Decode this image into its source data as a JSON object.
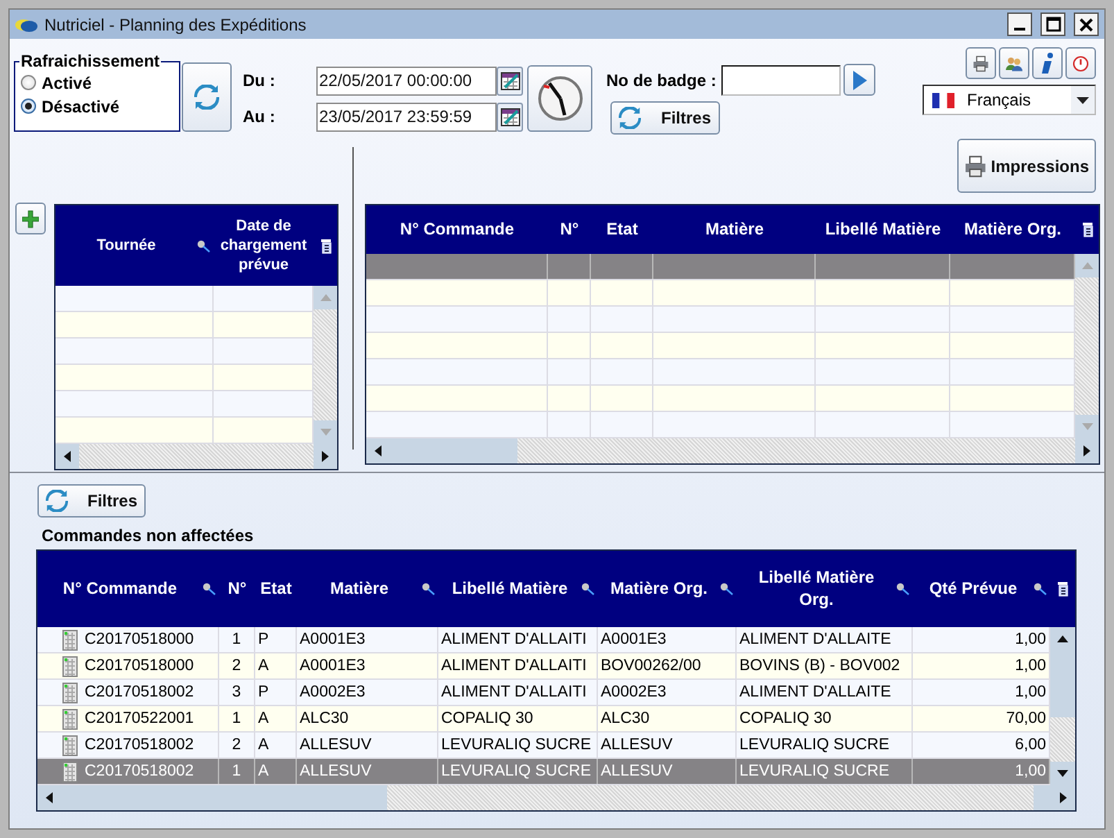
{
  "window": {
    "title": "Nutriciel - Planning des Expéditions"
  },
  "refresh": {
    "title": "Rafraichissement",
    "options": [
      {
        "label": "Activé",
        "selected": false
      },
      {
        "label": "Désactivé",
        "selected": true
      }
    ]
  },
  "period": [
    {
      "label": "Du :",
      "value": "22/05/2017 00:00:00"
    },
    {
      "label": "Au :",
      "value": "23/05/2017 23:59:59"
    }
  ],
  "badge": {
    "label": "No de badge :"
  },
  "filters_button": "Filtres",
  "language": {
    "value": "Français"
  },
  "print_button": "Impressions",
  "tours_grid": {
    "columns": [
      "Tournée",
      "Date de chargement prévue"
    ],
    "rows": [
      {
        "selected": false
      },
      {
        "selected": false
      },
      {
        "selected": false
      },
      {
        "selected": false
      },
      {
        "selected": false
      },
      {
        "selected": false
      }
    ]
  },
  "orders_grid": {
    "columns": [
      "N° Commande",
      "N°",
      "Etat",
      "Matière",
      "Libellé Matière",
      "Matière Org."
    ],
    "rows": [
      {
        "selected": true
      },
      {
        "selected": false
      },
      {
        "selected": false
      },
      {
        "selected": false
      },
      {
        "selected": false
      },
      {
        "selected": false
      },
      {
        "selected": false
      }
    ]
  },
  "unassigned": {
    "filters_button": "Filtres",
    "title": "Commandes non affectées",
    "columns": [
      "N° Commande",
      "N°",
      "Etat",
      "Matière",
      "Libellé Matière",
      "Matière Org.",
      "Libellé Matière Org.",
      "Qté Prévue"
    ],
    "rows": [
      {
        "cells": [
          "C20170518000",
          "1",
          "P",
          "A0001E3",
          "ALIMENT D'ALLAITI",
          "A0001E3",
          "ALIMENT D'ALLAITE",
          "1,00"
        ],
        "selected": false
      },
      {
        "cells": [
          "C20170518000",
          "2",
          "A",
          "A0001E3",
          "ALIMENT D'ALLAITI",
          "BOV00262/00",
          "BOVINS (B) - BOV002",
          "1,00"
        ],
        "selected": false
      },
      {
        "cells": [
          "C20170518002",
          "3",
          "P",
          "A0002E3",
          "ALIMENT D'ALLAITI",
          "A0002E3",
          "ALIMENT D'ALLAITE",
          "1,00"
        ],
        "selected": false
      },
      {
        "cells": [
          "C20170522001",
          "1",
          "A",
          "ALC30",
          "COPALIQ 30",
          "ALC30",
          "COPALIQ 30",
          "70,00"
        ],
        "selected": false
      },
      {
        "cells": [
          "C20170518002",
          "2",
          "A",
          "ALLESUV",
          "LEVURALIQ SUCRE",
          "ALLESUV",
          "LEVURALIQ SUCRE",
          "6,00"
        ],
        "selected": false
      },
      {
        "cells": [
          "C20170518002",
          "1",
          "A",
          "ALLESUV",
          "LEVURALIQ SUCRE",
          "ALLESUV",
          "LEVURALIQ SUCRE",
          "1,00"
        ],
        "selected": true
      }
    ]
  }
}
